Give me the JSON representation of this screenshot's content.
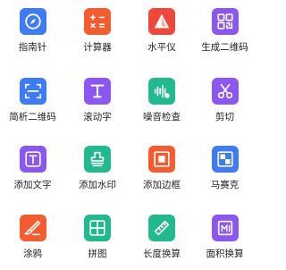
{
  "tools": [
    {
      "label": "指南针",
      "icon": "compass-icon",
      "color": "#3f7bf5"
    },
    {
      "label": "计算器",
      "icon": "calculator-icon",
      "color": "#f45b2f"
    },
    {
      "label": "水平仪",
      "icon": "level-icon",
      "color": "#f0473c"
    },
    {
      "label": "生成二维码",
      "icon": "qr-generate-icon",
      "color": "#8b57f0"
    },
    {
      "label": "简析二维码",
      "icon": "qr-scan-icon",
      "color": "#3f7bf5"
    },
    {
      "label": "滚动字",
      "icon": "scroll-text-icon",
      "color": "#8b57f0"
    },
    {
      "label": "噪音检查",
      "icon": "noise-icon",
      "color": "#22b98f"
    },
    {
      "label": "剪切",
      "icon": "scissors-icon",
      "color": "#8b57f0"
    },
    {
      "label": "添加文字",
      "icon": "add-text-icon",
      "color": "#8b57f0"
    },
    {
      "label": "添加水印",
      "icon": "watermark-icon",
      "color": "#22b98f"
    },
    {
      "label": "添加边框",
      "icon": "border-icon",
      "color": "#f45b2f"
    },
    {
      "label": "马赛克",
      "icon": "mosaic-icon",
      "color": "#3f7bf5"
    },
    {
      "label": "涂鸦",
      "icon": "doodle-icon",
      "color": "#f45b2f"
    },
    {
      "label": "拼图",
      "icon": "puzzle-icon",
      "color": "#22b98f"
    },
    {
      "label": "长度换算",
      "icon": "ruler-icon",
      "color": "#22b98f"
    },
    {
      "label": "面积换算",
      "icon": "area-icon",
      "color": "#8b57f0"
    }
  ]
}
